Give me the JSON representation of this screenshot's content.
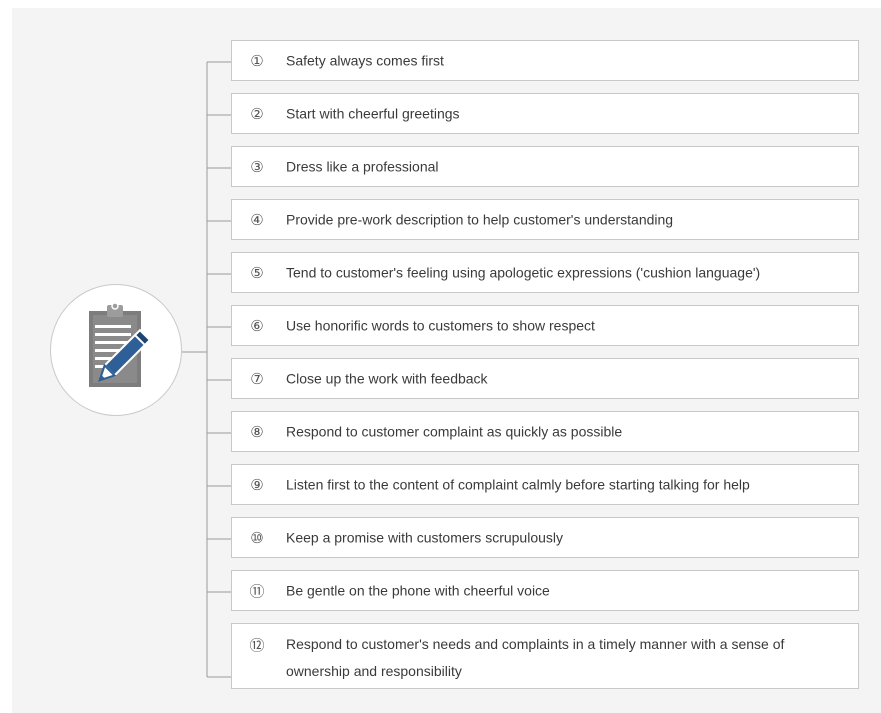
{
  "icon": "clipboard-pencil-icon",
  "colors": {
    "panel_background": "#f4f4f4",
    "box_border": "#c8c8c8",
    "connector": "#9a9a9a",
    "pencil": "#2e5f97"
  },
  "items": [
    {
      "num": "①",
      "text": "Safety always comes first"
    },
    {
      "num": "②",
      "text": "Start with cheerful greetings"
    },
    {
      "num": "③",
      "text": "Dress like a professional"
    },
    {
      "num": "④",
      "text": "Provide pre-work description to help customer's understanding"
    },
    {
      "num": "⑤",
      "text": "Tend to customer's feeling using apologetic expressions ('cushion language')"
    },
    {
      "num": "⑥",
      "text": "Use honorific words to customers to show respect"
    },
    {
      "num": "⑦",
      "text": "Close up the work with feedback"
    },
    {
      "num": "⑧",
      "text": "Respond to customer complaint as quickly as possible"
    },
    {
      "num": "⑨",
      "text": "Listen first to the content of complaint calmly before starting talking for help"
    },
    {
      "num": "⑩",
      "text": "Keep a promise with customers scrupulously"
    },
    {
      "num": "⑪",
      "text": "Be gentle on the phone with cheerful voice"
    },
    {
      "num": "⑫",
      "text": "Respond to customer's needs and complaints in a timely manner with a sense of ownership and responsibility"
    }
  ]
}
